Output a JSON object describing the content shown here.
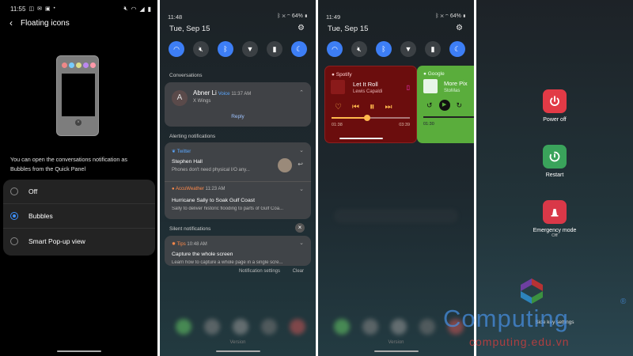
{
  "panel1": {
    "status_time": "11:55",
    "status_icons_left": [
      "instagram-icon",
      "mail-icon",
      "gallery-icon",
      "dot"
    ],
    "status_icons_right": [
      "mute-icon",
      "wifi-icon",
      "signal-icon",
      "battery-icon"
    ],
    "title": "Floating icons",
    "description": "You can open the conversations notification as Bubbles from the Quick Panel",
    "options": [
      {
        "label": "Off",
        "selected": false
      },
      {
        "label": "Bubbles",
        "selected": true
      },
      {
        "label": "Smart Pop-up view",
        "selected": false
      }
    ],
    "mock_colors": [
      "#e88",
      "#7cf",
      "#dd8",
      "#b8e",
      "#f9a"
    ]
  },
  "panel2": {
    "time": "11:48",
    "battery": "64%",
    "date": "Tue, Sep 15",
    "tiles": [
      {
        "icon": "wifi-icon",
        "on": true
      },
      {
        "icon": "mute-icon",
        "on": false
      },
      {
        "icon": "bluetooth-icon",
        "on": true
      },
      {
        "icon": "flashlight-icon",
        "on": false
      },
      {
        "icon": "battery-saver-icon",
        "on": false
      },
      {
        "icon": "night-mode-icon",
        "on": true
      }
    ],
    "conversations_label": "Conversations",
    "conv": {
      "avatar": "A",
      "name": "Abner Li",
      "app": "Voice",
      "time": "11:37 AM",
      "message": "X Wings",
      "reply": "Reply"
    },
    "alerting_label": "Alerting notifications",
    "twitter": {
      "app": "Twitter",
      "title": "Stephen Hall",
      "body": "Phones don't need physical I/O any..."
    },
    "weather": {
      "app": "AccuWeather",
      "time": "11:23 AM",
      "title": "Hurricane Sally to Soak Gulf Coast",
      "body": "Sally to deliver historic flooding to parts of Gulf Coa..."
    },
    "silent_label": "Silent notifications",
    "tips": {
      "app": "Tips",
      "time": "10:48 AM",
      "title": "Capture the whole screen",
      "body": "Learn how to capture a whole page in a single scre..."
    },
    "notif_settings": "Notification settings",
    "clear": "Clear",
    "version": "Version"
  },
  "panel3": {
    "time": "11:49",
    "battery": "64%",
    "date": "Tue, Sep 15",
    "spotify": {
      "app": "Spotify",
      "song": "Let It Roll",
      "artist": "Lewis Capaldi",
      "elapsed": "01:38",
      "total": "03:39",
      "progress": 0.45
    },
    "google": {
      "app": "Google",
      "title": "More Pix",
      "sub": "StoMas",
      "elapsed": "01:30"
    },
    "version": "Version"
  },
  "panel4": {
    "power_off": "Power off",
    "restart": "Restart",
    "emergency": "Emergency mode",
    "emergency_state": "Off",
    "side_key": "Side key settings"
  },
  "watermark": {
    "brand": "Computing",
    "registered": "®",
    "url": "computing.edu.vn"
  }
}
